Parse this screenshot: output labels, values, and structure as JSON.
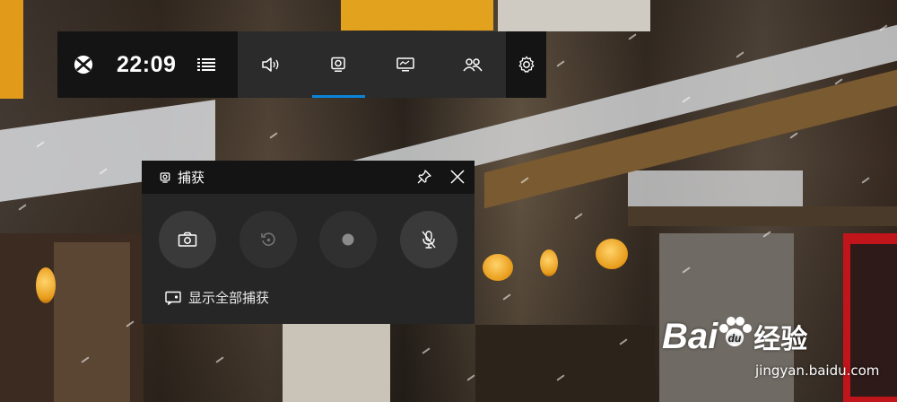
{
  "topbar": {
    "time": "22:09",
    "icons": {
      "xbox": "xbox-icon",
      "menu": "menu-icon",
      "audio": "audio-icon",
      "capture": "capture-icon",
      "performance": "performance-icon",
      "social": "social-icon",
      "settings": "gear-icon"
    },
    "active_widget": "capture",
    "accent": "#0a84d8"
  },
  "capture_widget": {
    "title": "捕获",
    "show_all_label": "显示全部捕获",
    "buttons": [
      {
        "name": "screenshot",
        "icon": "camera-icon",
        "enabled": true
      },
      {
        "name": "record-last",
        "icon": "replay-icon",
        "enabled": false
      },
      {
        "name": "record",
        "icon": "record-dot-icon",
        "enabled": false
      },
      {
        "name": "microphone",
        "icon": "mic-off-icon",
        "enabled": true
      }
    ]
  },
  "watermark": {
    "brand": "Bai",
    "brand_suffix": "经验",
    "url": "jingyan.baidu.com"
  }
}
